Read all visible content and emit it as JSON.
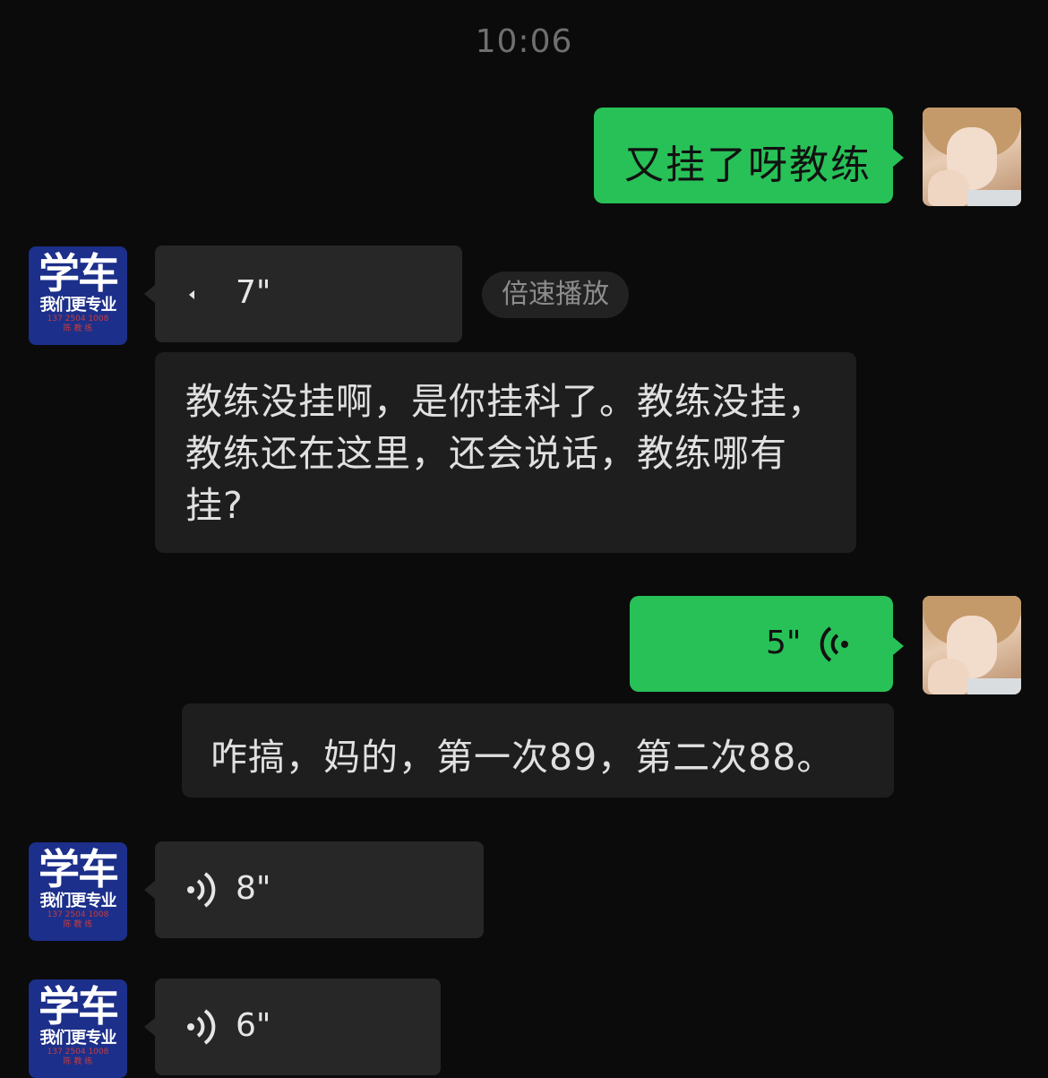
{
  "status": {
    "time": "10:06"
  },
  "messages": {
    "m1": {
      "text": "又挂了呀教练"
    },
    "m2": {
      "duration": "7\"",
      "speed_button": "倍速播放",
      "transcript": "教练没挂啊，是你挂科了。教练没挂，教练还在这里，还会说话，教练哪有挂?"
    },
    "m3": {
      "duration": "5\"",
      "transcript": "咋搞，妈的，第一次89，第二次88。"
    },
    "m4": {
      "duration": "8\""
    },
    "m5": {
      "duration": "6\""
    }
  },
  "coach_avatar": {
    "line1": "学车",
    "line2": "我们更专业",
    "line3": "137 2504 1008",
    "line4": "陈 教 练"
  },
  "colors": {
    "sent_bubble": "#28c157",
    "received_bubble": "#272727",
    "background": "#0b0b0b",
    "coach_avatar_bg": "#1c2f8a"
  },
  "icons": {
    "voice_received": "voice-wave-icon",
    "voice_sent": "voice-wave-icon-sent"
  }
}
